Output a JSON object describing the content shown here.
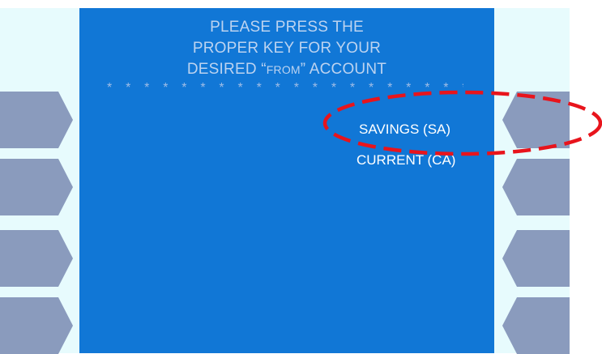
{
  "screen": {
    "heading_line1": "PLEASE PRESS THE",
    "heading_line2": "PROPER KEY FOR YOUR",
    "heading_line3_a": "DESIRED “",
    "heading_line3_b": "FROM",
    "heading_line3_c": "” ACCOUNT",
    "separator": "* * * * * * * * * * * * * * * * * * * * * * * * * *",
    "options": [
      {
        "label": "SAVINGS (SA)"
      },
      {
        "label": "CURRENT (CA)"
      }
    ]
  },
  "colors": {
    "screen_bg": "#1177d6",
    "side_panel_bg": "#e7fbfd",
    "key_fill": "#8a9bbd",
    "heading_text": "#bcd3f0",
    "highlight_ellipse": "#e8141c"
  },
  "highlight": {
    "target": "SAVINGS (SA)",
    "style": "red dashed ellipse"
  }
}
